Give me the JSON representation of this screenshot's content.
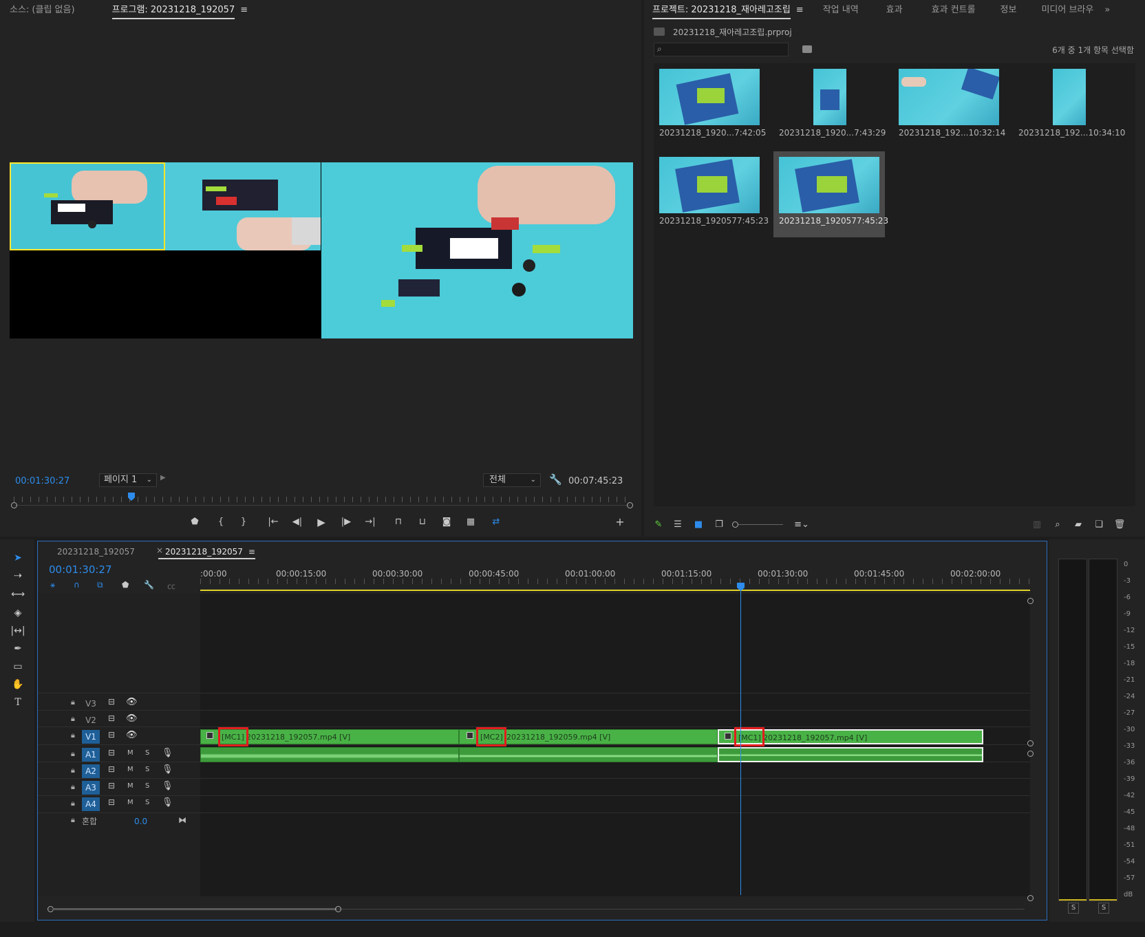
{
  "source_monitor": {
    "tab_label": "소스: (클립 없음)"
  },
  "program_monitor": {
    "tab_label": "프로그램: 20231218_192057",
    "timecode": "00:01:30:27",
    "page_select": "페이지 1",
    "fit_select": "전체",
    "duration": "00:07:45:23"
  },
  "project_panel": {
    "tabs": [
      "프로젝트: 20231218_재아레고조립",
      "작업 내역",
      "효과",
      "효과 컨트롤",
      "정보",
      "미디어 브라우"
    ],
    "overflow": "»",
    "project_file": "20231218_재아레고조립.prproj",
    "search_placeholder": "",
    "selection_status": "6개 중 1개 항목 선택함",
    "items": [
      {
        "name": "20231218_1920...",
        "duration": "7:42:05"
      },
      {
        "name": "20231218_1920...",
        "duration": "7:43:29"
      },
      {
        "name": "20231218_192...",
        "duration": "10:32:14"
      },
      {
        "name": "20231218_192...",
        "duration": "10:34:10"
      },
      {
        "name": "20231218_192057",
        "duration": "7:45:23"
      },
      {
        "name": "20231218_192057",
        "duration": "7:45:23"
      }
    ]
  },
  "timeline": {
    "tabs": [
      "20231218_192057",
      "20231218_192057"
    ],
    "close_mark": "×",
    "timecode": "00:01:30:27",
    "ruler": [
      ":00:00",
      "00:00:15:00",
      "00:00:30:00",
      "00:00:45:00",
      "00:01:00:00",
      "00:01:15:00",
      "00:01:30:00",
      "00:01:45:00",
      "00:02:00:00"
    ],
    "video_tracks": [
      "V3",
      "V2",
      "V1"
    ],
    "audio_tracks": [
      "A1",
      "A2",
      "A3",
      "A4"
    ],
    "mix_label": "혼합",
    "mix_value": "0.0",
    "m_label": "M",
    "s_label": "S",
    "clips": [
      {
        "prefix": "[MC1]",
        "name": "20231218_192057.mp4 [V]"
      },
      {
        "prefix": "[MC2]",
        "name": "20231218_192059.mp4 [V]"
      },
      {
        "prefix": "[MC1]",
        "name": "20231218_192057.mp4 [V]"
      }
    ]
  },
  "audio_meter": {
    "scale": [
      "0",
      "-3",
      "-6",
      "-9",
      "-12",
      "-15",
      "-18",
      "-21",
      "-24",
      "-27",
      "-30",
      "-33",
      "-36",
      "-39",
      "-42",
      "-45",
      "-48",
      "-51",
      "-54",
      "-57",
      "dB"
    ],
    "solo_left": "S",
    "solo_right": "S"
  },
  "colors": {
    "accent": "#2d8ceb",
    "clip_green": "#49b246",
    "highlight": "#e21d1d",
    "playhead": "#2d8ceb"
  }
}
